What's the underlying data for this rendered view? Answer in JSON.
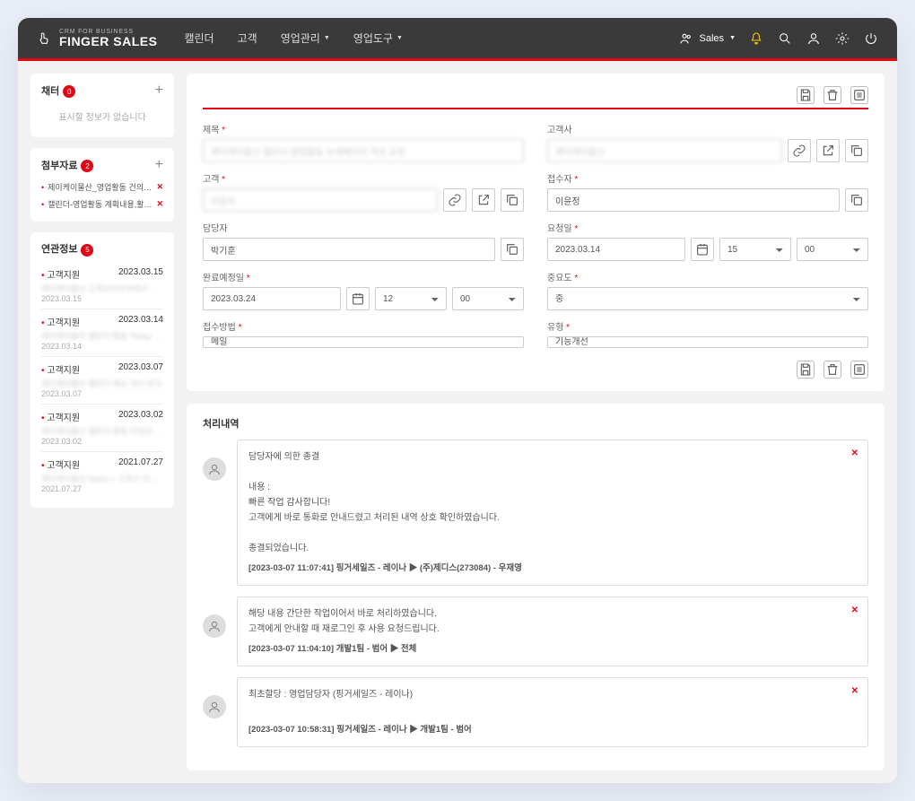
{
  "header": {
    "logo_sub": "CRM FOR BUSINESS",
    "logo_main": "FINGER SALES",
    "nav": [
      "캘린더",
      "고객",
      "영업관리",
      "영업도구"
    ],
    "nav_has_sub": [
      false,
      false,
      true,
      true
    ],
    "user_label": "Sales"
  },
  "sidebar": {
    "chatter": {
      "title": "채터",
      "count": "0",
      "empty": "표시할 정보가 없습니다"
    },
    "attach": {
      "title": "첨부자료",
      "count": "2",
      "items": [
        {
          "t": "제이케이물산_영업활동 건의사항…"
        },
        {
          "t": "캘린더-영업활동 계획내용,활동내…"
        }
      ]
    },
    "related": {
      "title": "연관정보",
      "count": "5",
      "items": [
        {
          "cat": "고객지원",
          "date": "2023.03.15",
          "desc": "제이케이물산 고객브라우저에서 고…",
          "sub": "2023.03.15"
        },
        {
          "cat": "고객지원",
          "date": "2023.03.14",
          "desc": "제이케이물산 캘린더 활동 Today …",
          "sub": "2023.03.14"
        },
        {
          "cat": "고객지원",
          "date": "2023.03.07",
          "desc": "제이케이물산 캘린더 메뉴 개선 문의",
          "sub": "2023.03.07"
        },
        {
          "cat": "고객지원",
          "date": "2023.03.02",
          "desc": "제이케이물산 캘린더-활동 타임라…",
          "sub": "2023.03.02"
        },
        {
          "cat": "고객지원",
          "date": "2021.07.27",
          "desc": "제이케이물산 Sales > 고객사 이전…",
          "sub": "2021.07.27"
        }
      ]
    }
  },
  "form": {
    "title": {
      "label": "제목",
      "value": "제이케이물산 캘린더-영업활동 상세페이지 개선 요청"
    },
    "client": {
      "label": "고객사",
      "value": "제이케이물산"
    },
    "customer": {
      "label": "고객",
      "value": "이동욱"
    },
    "receiver": {
      "label": "접수자",
      "value": "이윤정"
    },
    "assignee": {
      "label": "담당자",
      "value": "박기훈"
    },
    "reqdate": {
      "label": "요청일",
      "value": "2023.03.14",
      "hh": "15",
      "mm": "00"
    },
    "duedate": {
      "label": "완료예정일",
      "value": "2023.03.24",
      "hh": "12",
      "mm": "00"
    },
    "priority": {
      "label": "중요도",
      "value": "중"
    },
    "channel": {
      "label": "접수방법",
      "value": "메일"
    },
    "type": {
      "label": "유형",
      "value": "기능개선"
    }
  },
  "history": {
    "title": "처리내역",
    "items": [
      {
        "head": "담당자에 의한 종결",
        "body": "내용 :\n빠른 작업 감사합니다!\n고객에게 바로 통화로 안내드렸고 처리된 내역 상호 확인하였습니다.\n\n종결되었습니다.",
        "meta": "[2023-03-07 11:07:41] 핑거세일즈 - 레이나 ▶ (주)제디스(273084) - 우재영"
      },
      {
        "head": "",
        "body": "해당 내용 간단한 작업이어서 바로 처리하였습니다.\n고객에게 안내할 때 재로그인 후 사용 요청드립니다.",
        "meta": "[2023-03-07 11:04:10] 개발1팀 - 범어 ▶ 전체"
      },
      {
        "head": "최초할당 : 영업담당자 (핑거세일즈 - 레이나)",
        "body": "",
        "meta": "[2023-03-07 10:58:31] 핑거세일즈 - 레이나 ▶ 개발1팀 - 범어"
      }
    ]
  }
}
